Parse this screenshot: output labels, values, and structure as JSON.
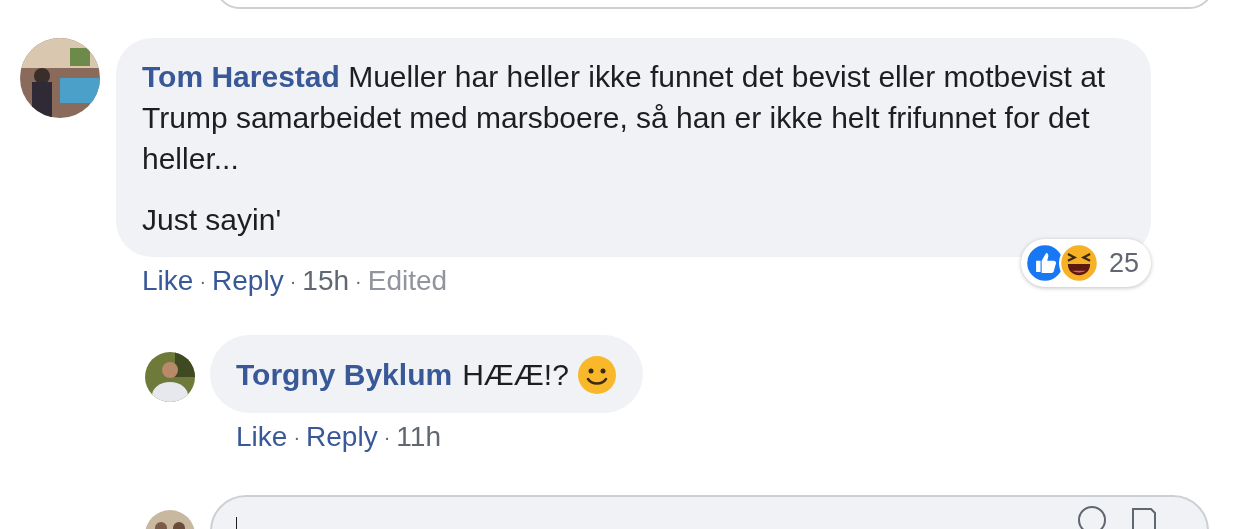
{
  "comments": [
    {
      "author": "Tom Harestad",
      "paragraphs": [
        "Mueller har heller ikke funnet det bevist eller motbevist at Trump samarbeidet med marsboere, så han er ikke helt frifunnet for det heller...",
        "Just sayin'"
      ],
      "like": "Like",
      "sep1": "·",
      "reply": "Reply",
      "sep2": "·",
      "time": "15h",
      "sep3": "·",
      "edited": "Edited",
      "reactions": {
        "count": "25"
      },
      "replies": [
        {
          "author": "Torgny Byklum",
          "paragraphs": [
            "HÆÆ!?"
          ],
          "smiley": true,
          "like": "Like",
          "sep1": "·",
          "reply": "Reply",
          "sep2": "·",
          "time": "11h"
        }
      ]
    }
  ]
}
